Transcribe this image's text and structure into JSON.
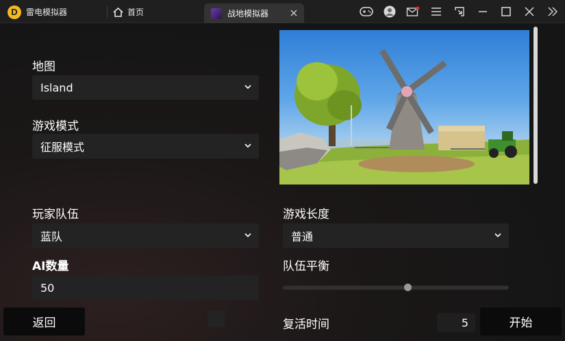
{
  "titlebar": {
    "app_name": "雷电模拟器",
    "logo_letter": "D",
    "home_label": "首页",
    "game_tab_label": "战地模拟器"
  },
  "settings": {
    "map": {
      "label": "地图",
      "value": "Island"
    },
    "game_mode": {
      "label": "游戏模式",
      "value": "征服模式"
    },
    "player_team": {
      "label": "玩家队伍",
      "value": "蓝队"
    },
    "ai_count": {
      "label": "AI数量",
      "value": "50"
    },
    "game_length": {
      "label": "游戏长度",
      "value": "普通"
    },
    "team_balance": {
      "label": "队伍平衡",
      "level": 0.55
    },
    "respawn_time": {
      "label": "复活时间",
      "value": "5"
    }
  },
  "buttons": {
    "back": "返回",
    "start": "开始"
  },
  "colors": {
    "logo": "#f3b920",
    "notification_dot": "#e0303a"
  }
}
